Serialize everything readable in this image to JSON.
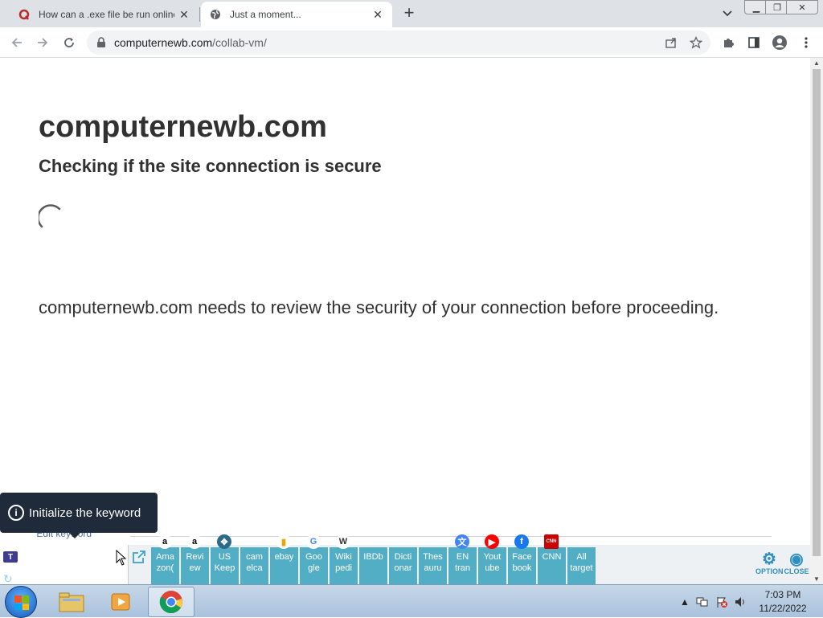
{
  "tabs": [
    {
      "title": "How can a .exe file be run online",
      "favicon": "quora-icon",
      "active": false
    },
    {
      "title": "Just a moment...",
      "favicon": "globe-icon",
      "active": true
    }
  ],
  "toolbar": {
    "url_host": "computernewb.com",
    "url_path": "/collab-vm/"
  },
  "page": {
    "heading": "computernewb.com",
    "subheading": "Checking if the site connection is secure",
    "paragraph": "computernewb.com needs to review the security of your connection before proceeding."
  },
  "tooltip": {
    "text": "Initialize the keyword",
    "edit_link": "Edit keyword"
  },
  "extension": {
    "logo": "T",
    "tiles": [
      {
        "label": "Ama zon(",
        "icon": "amazon-icon",
        "glyph": "a"
      },
      {
        "label": "Revi ew",
        "icon": "amazon-icon",
        "glyph": "a"
      },
      {
        "label": "US Keep",
        "icon": "keep-icon",
        "glyph": "✥"
      },
      {
        "label": "cam elca",
        "icon": "",
        "glyph": ""
      },
      {
        "label": "ebay",
        "icon": "shopping-bag-icon",
        "glyph": "▮"
      },
      {
        "label": "Goo gle",
        "icon": "google-icon",
        "glyph": "G"
      },
      {
        "label": "Wiki pedi",
        "icon": "wikipedia-icon",
        "glyph": "W"
      },
      {
        "label": "IBDb",
        "icon": "",
        "glyph": ""
      },
      {
        "label": "Dicti onar",
        "icon": "",
        "glyph": ""
      },
      {
        "label": "Thes auru",
        "icon": "",
        "glyph": ""
      },
      {
        "label": "EN tran",
        "icon": "translate-icon",
        "glyph": "文"
      },
      {
        "label": "Yout ube",
        "icon": "youtube-icon",
        "glyph": "▶"
      },
      {
        "label": "Face book",
        "icon": "facebook-icon",
        "glyph": "f"
      },
      {
        "label": "CNN",
        "icon": "cnn-icon",
        "glyph": "CNN"
      },
      {
        "label": "All target",
        "icon": "",
        "glyph": ""
      }
    ],
    "option_label": "OPTION",
    "close_label": "CLOSE"
  },
  "taskbar": {
    "time": "7:03 PM",
    "date": "11/22/2022"
  },
  "colors": {
    "tile": "#52aec4",
    "tooltip_bg": "#1f2a3a",
    "tabstrip": "#dee1e6"
  }
}
